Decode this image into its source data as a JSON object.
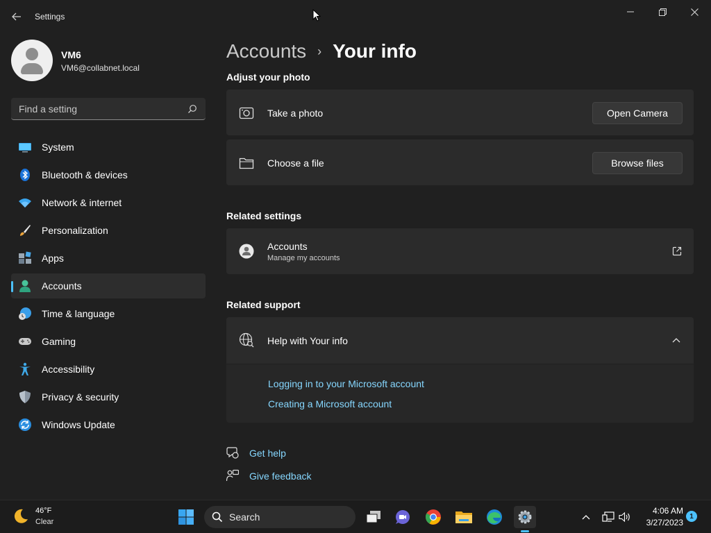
{
  "titlebar": {
    "app_title": "Settings",
    "back_icon": "back-arrow-icon",
    "minimize_icon": "minimize-icon",
    "maximize_icon": "restore-icon",
    "close_icon": "close-icon"
  },
  "profile": {
    "name": "VM6",
    "email": "VM6@collabnet.local"
  },
  "search": {
    "placeholder": "Find a setting"
  },
  "sidebar": {
    "items": [
      {
        "label": "System",
        "icon": "system-icon"
      },
      {
        "label": "Bluetooth & devices",
        "icon": "bluetooth-icon"
      },
      {
        "label": "Network & internet",
        "icon": "wifi-icon"
      },
      {
        "label": "Personalization",
        "icon": "brush-icon"
      },
      {
        "label": "Apps",
        "icon": "apps-icon"
      },
      {
        "label": "Accounts",
        "icon": "accounts-icon",
        "active": true
      },
      {
        "label": "Time & language",
        "icon": "clock-globe-icon"
      },
      {
        "label": "Gaming",
        "icon": "gamepad-icon"
      },
      {
        "label": "Accessibility",
        "icon": "accessibility-icon"
      },
      {
        "label": "Privacy & security",
        "icon": "shield-icon"
      },
      {
        "label": "Windows Update",
        "icon": "update-icon"
      }
    ]
  },
  "main": {
    "breadcrumb_parent": "Accounts",
    "breadcrumb_separator": "›",
    "breadcrumb_current": "Your info",
    "adjust_photo_title": "Adjust your photo",
    "take_photo_label": "Take a photo",
    "open_camera_label": "Open Camera",
    "choose_file_label": "Choose a file",
    "browse_files_label": "Browse files",
    "related_settings_title": "Related settings",
    "accounts_card_label": "Accounts",
    "accounts_card_sub": "Manage my accounts",
    "related_support_title": "Related support",
    "help_label": "Help with Your info",
    "help_links": [
      "Logging in to your Microsoft account",
      "Creating a Microsoft account"
    ],
    "get_help_label": "Get help",
    "give_feedback_label": "Give feedback"
  },
  "taskbar": {
    "weather_temp": "46°F",
    "weather_cond": "Clear",
    "search_label": "Search",
    "time": "4:06 AM",
    "date": "3/27/2023",
    "notification_count": "1"
  },
  "colors": {
    "accent": "#4cc2ff",
    "link": "#86d7ff",
    "background": "#202020",
    "card": "#2b2b2b"
  }
}
